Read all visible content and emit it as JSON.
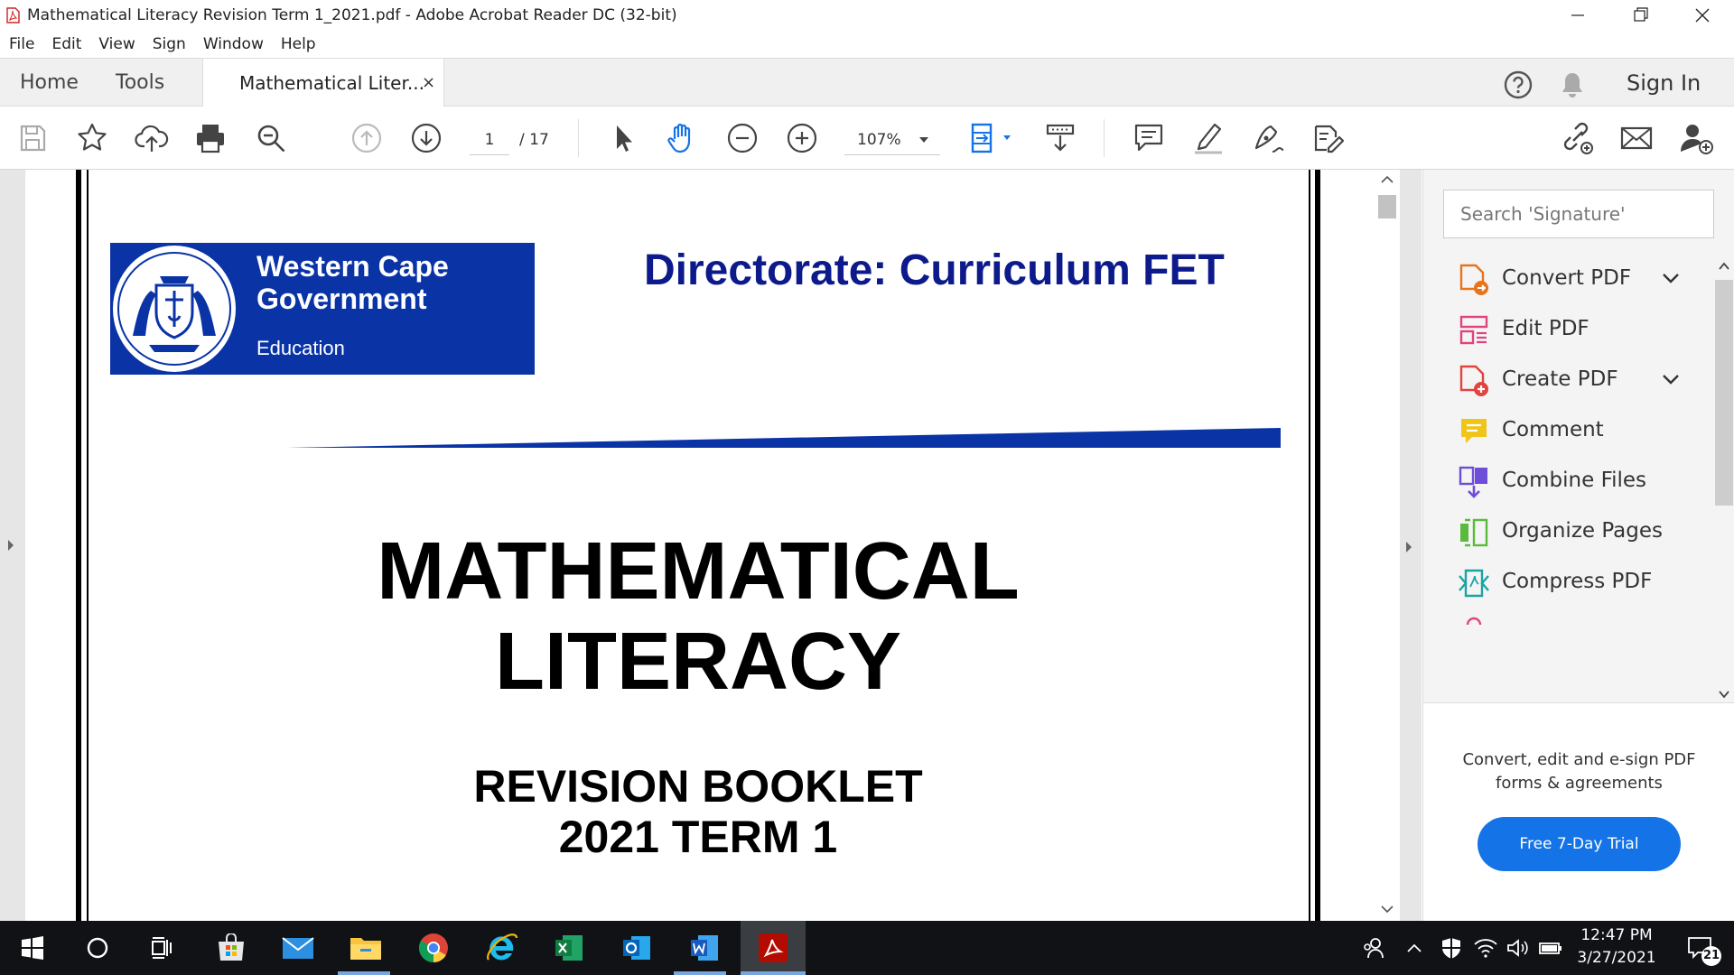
{
  "window": {
    "title": "Mathematical Literacy Revision Term 1_2021.pdf - Adobe Acrobat Reader DC (32-bit)",
    "accent": "#1473e6"
  },
  "menu": [
    "File",
    "Edit",
    "View",
    "Sign",
    "Window",
    "Help"
  ],
  "tabs": {
    "home": "Home",
    "tools": "Tools",
    "document": "Mathematical Liter...",
    "close": "×",
    "sign_in": "Sign In"
  },
  "toolbar": {
    "page_current": "1",
    "page_total": "/ 17",
    "zoom": "107%"
  },
  "document": {
    "logo_line1": "Western Cape",
    "logo_line2": "Government",
    "logo_dept": "Education",
    "directorate": "Directorate: Curriculum FET",
    "title_line1": "MATHEMATICAL",
    "title_line2": "LITERACY",
    "subtitle_line1": "REVISION BOOKLET",
    "subtitle_line2": "2021 TERM 1",
    "brand_color": "#0a33a6",
    "heading_color": "#0d1a8c"
  },
  "right_panel": {
    "search_placeholder": "Search 'Signature'",
    "tools": [
      {
        "label": "Convert PDF",
        "icon": "convert-pdf-icon",
        "color": "#e8731a",
        "expandable": true
      },
      {
        "label": "Edit PDF",
        "icon": "edit-pdf-icon",
        "color": "#e0437e",
        "expandable": false
      },
      {
        "label": "Create PDF",
        "icon": "create-pdf-icon",
        "color": "#e0443e",
        "expandable": true
      },
      {
        "label": "Comment",
        "icon": "comment-icon",
        "color": "#f0c419",
        "expandable": false
      },
      {
        "label": "Combine Files",
        "icon": "combine-files-icon",
        "color": "#6e4ed8",
        "expandable": false
      },
      {
        "label": "Organize Pages",
        "icon": "organize-pages-icon",
        "color": "#5aba3c",
        "expandable": false
      },
      {
        "label": "Compress PDF",
        "icon": "compress-pdf-icon",
        "color": "#1aa3a3",
        "expandable": false
      }
    ],
    "promo_text": "Convert, edit and e-sign PDF forms & agreements",
    "trial_button": "Free 7-Day Trial"
  },
  "taskbar": {
    "time": "12:47 PM",
    "date": "3/27/2021",
    "notification_count": "21"
  }
}
